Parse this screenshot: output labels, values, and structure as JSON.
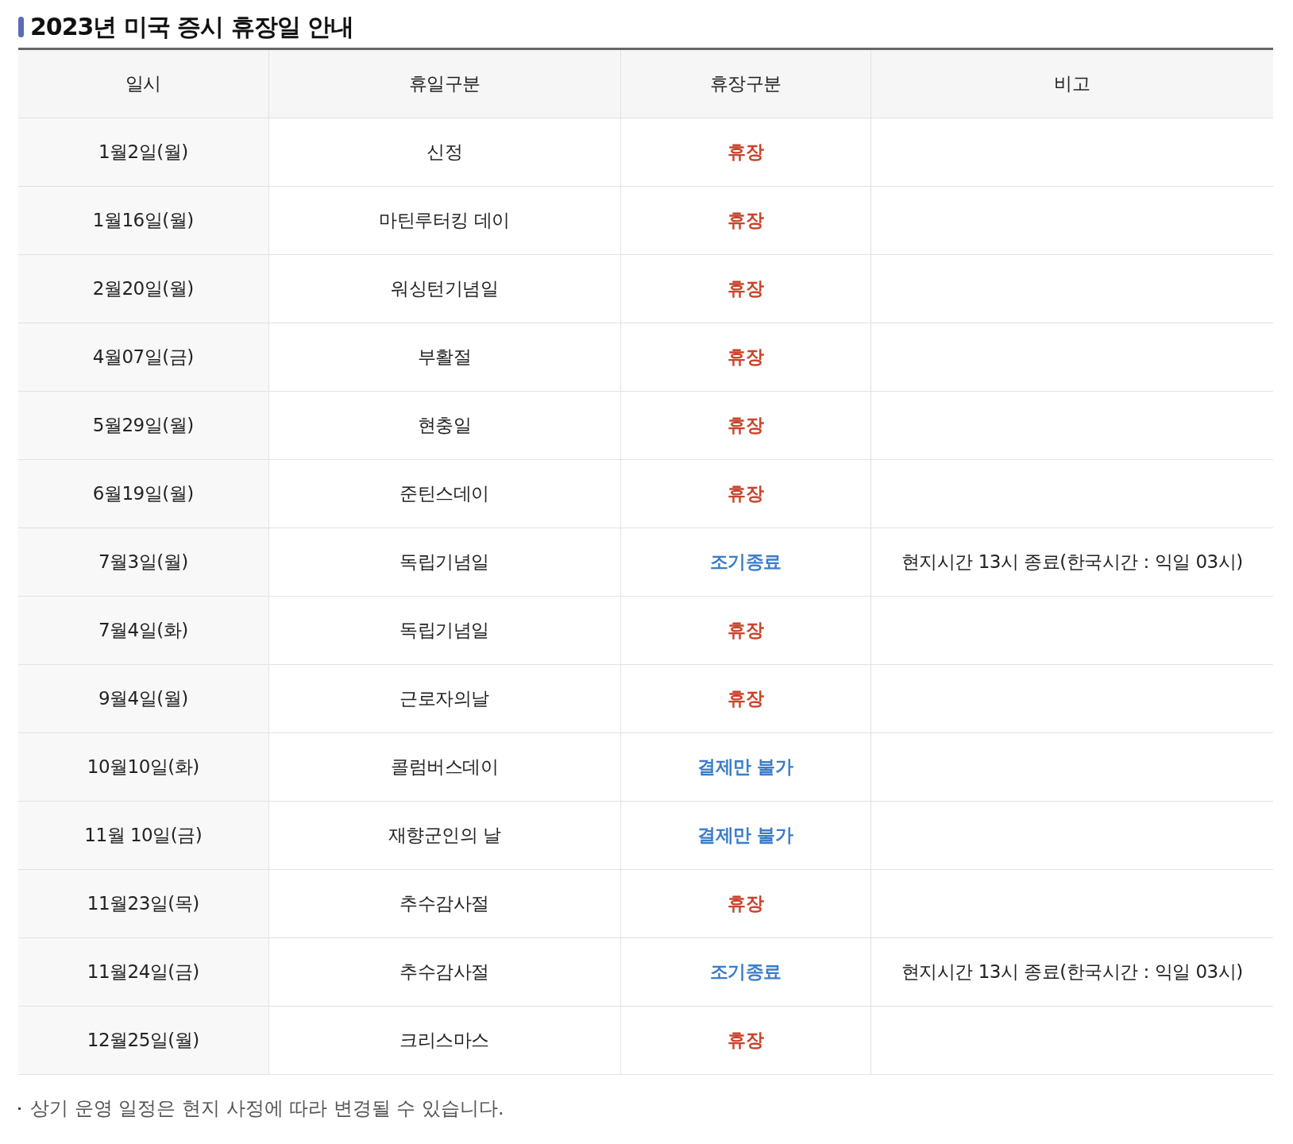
{
  "title": "2023년 미국 증시 휴장일 안내",
  "table": {
    "columns": [
      "일시",
      "휴일구분",
      "휴장구분",
      "비고"
    ],
    "rows": [
      {
        "date": "1월2일(월)",
        "holiday": "신정",
        "status": "휴장",
        "color": "#c9452d"
      },
      {
        "date": "1월16일(월)",
        "holiday": "마틴루터킹 데이",
        "status": "휴장",
        "color": "#c9452d"
      },
      {
        "date": "2월20일(월)",
        "holiday": "워싱턴기념일",
        "status": "휴장",
        "color": "#c9452d"
      },
      {
        "date": "4월07일(금)",
        "holiday": "부활절",
        "status": "휴장",
        "color": "#c9452d"
      },
      {
        "date": "5월29일(월)",
        "holiday": "현충일",
        "status": "휴장",
        "color": "#c9452d"
      },
      {
        "date": "6월19일(월)",
        "holiday": "준틴스데이",
        "status": "휴장",
        "color": "#c9452d"
      },
      {
        "date": "7월3일(월)",
        "holiday": "독립기념일",
        "status": "조기종료",
        "color": "#3b7dc9",
        "note": "현지시간 13시 종료(한국시간 : 익일 03시)"
      },
      {
        "date": "7월4일(화)",
        "holiday": "독립기념일",
        "status": "휴장",
        "color": "#c9452d"
      },
      {
        "date": "9월4일(월)",
        "holiday": "근로자의날",
        "status": "휴장",
        "color": "#c9452d"
      },
      {
        "date": "10월10일(화)",
        "holiday": "콜럼버스데이",
        "status": "결제만 불가",
        "color": "#3b7dc9"
      },
      {
        "date": "11월 10일(금)",
        "holiday": "재향군인의 날",
        "status": "결제만 불가",
        "color": "#3b7dc9"
      },
      {
        "date": "11월23일(목)",
        "holiday": "추수감사절",
        "status": "휴장",
        "color": "#c9452d"
      },
      {
        "date": "11월24일(금)",
        "holiday": "추수감사절",
        "status": "조기종료",
        "color": "#3b7dc9",
        "note": "현지시간 13시 종료(한국시간 : 익일 03시)"
      },
      {
        "date": "12월25일(월)",
        "holiday": "크리스마스",
        "status": "휴장",
        "color": "#c9452d"
      }
    ]
  },
  "footnote": "상기 운영 일정은 현지 사정에 따라 변경될 수 있습니다."
}
